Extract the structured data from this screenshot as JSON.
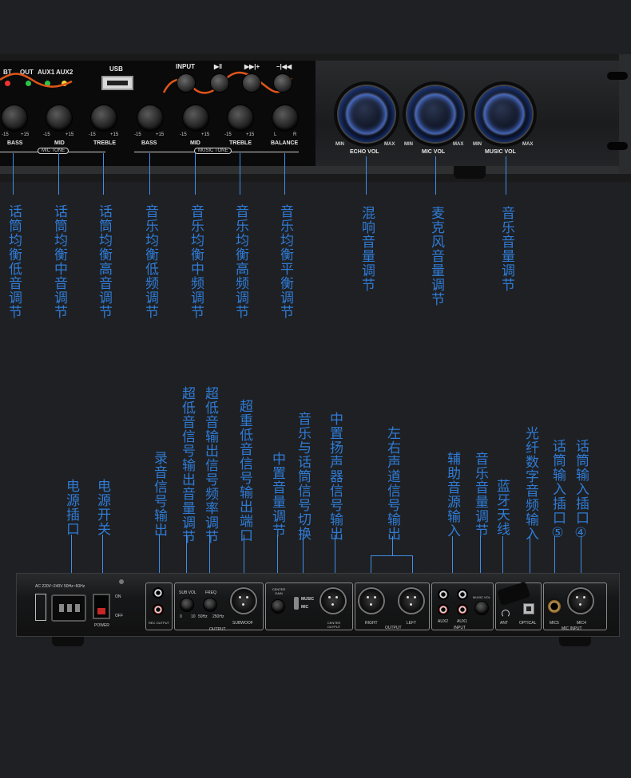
{
  "front_panel": {
    "indicators": [
      "BT",
      "OUT",
      "AUX1",
      "AUX2"
    ],
    "usb": "USB",
    "buttons": [
      "INPUT",
      "▶‖",
      "▶▶|+",
      "–|◀◀"
    ],
    "mic_knobs": [
      {
        "label": "BASS",
        "min": "-15",
        "max": "+15"
      },
      {
        "label": "MID",
        "min": "-15",
        "max": "+15"
      },
      {
        "label": "TREBLE",
        "min": "-15",
        "max": "+15"
      }
    ],
    "music_knobs": [
      {
        "label": "BASS",
        "min": "-15",
        "max": "+15"
      },
      {
        "label": "MID",
        "min": "-15",
        "max": "+15"
      },
      {
        "label": "TREBLE",
        "min": "-15",
        "max": "+15"
      },
      {
        "label": "BALANCE",
        "min": "L",
        "max": "R"
      }
    ],
    "mic_tone": "MIC TONE",
    "music_tone": "MUSIC TONE",
    "vol_knobs": [
      {
        "label": "ECHO VOL",
        "min": "MIN",
        "max": "MAX"
      },
      {
        "label": "MIC VOL",
        "min": "MIN",
        "max": "MAX"
      },
      {
        "label": "MUSIC VOL",
        "min": "MIN",
        "max": "MAX"
      }
    ]
  },
  "front_annotations": [
    "话筒均衡低音调节",
    "话筒均衡中音调节",
    "话筒均衡高音调节",
    "音乐均衡低频调节",
    "音乐均衡中频调节",
    "音乐均衡高频调节",
    "音乐均衡平衡调节",
    "混响音量调节",
    "麦克风音量调节",
    "音乐音量调节"
  ],
  "rear_annotations": [
    "电源插口",
    "电源开关",
    "录音信号输出",
    "超低音信号输出音量调节",
    "超低音输出信号频率调节",
    "超重低音信号输出端口",
    "中置音量调节",
    "音乐与话筒信号切换",
    "中置扬声器信号输出",
    "左右声道信号输出",
    "辅助音源输入",
    "音乐音量调节",
    "蓝牙天线",
    "光纤数字音频输入",
    "话筒输入插口⑤",
    "话筒输入插口④"
  ],
  "rear_panel": {
    "power_rating": "AC 220V~240V 50Hz~60Hz",
    "on": "ON",
    "off": "OFF",
    "power": "POWER",
    "rec_output": "REC OUTPUT",
    "sub_vol": "SUB VOL",
    "freq": "FREQ",
    "sub_vol_range": [
      "0",
      "10"
    ],
    "freq_range": [
      "50Hz",
      "250Hz"
    ],
    "output": "OUTPUT",
    "subwoof": "SUBWOOF",
    "center_gain": "CENTER GAIN",
    "music": "MUSIC",
    "mic": "MIC",
    "center_output": "CENTER OUTPUT",
    "right": "RIGHT",
    "left": "LEFT",
    "lr_output": "OUTPUT",
    "aux2": "AUX2",
    "aux1": "AUX1",
    "input": "INPUT",
    "music_vol": "MUSIC VOL",
    "ant": "ANT",
    "optical": "OPTICAL",
    "mic5": "MIC5",
    "mic4": "MIC4",
    "mic_input": "MIC INPUT"
  },
  "colors": {
    "background": "#1f2023",
    "annotation": "#2f7bd6",
    "panel": "#0d0d0e",
    "knob_glow": "#5e8cff",
    "tone_curve": "#e0551a"
  }
}
